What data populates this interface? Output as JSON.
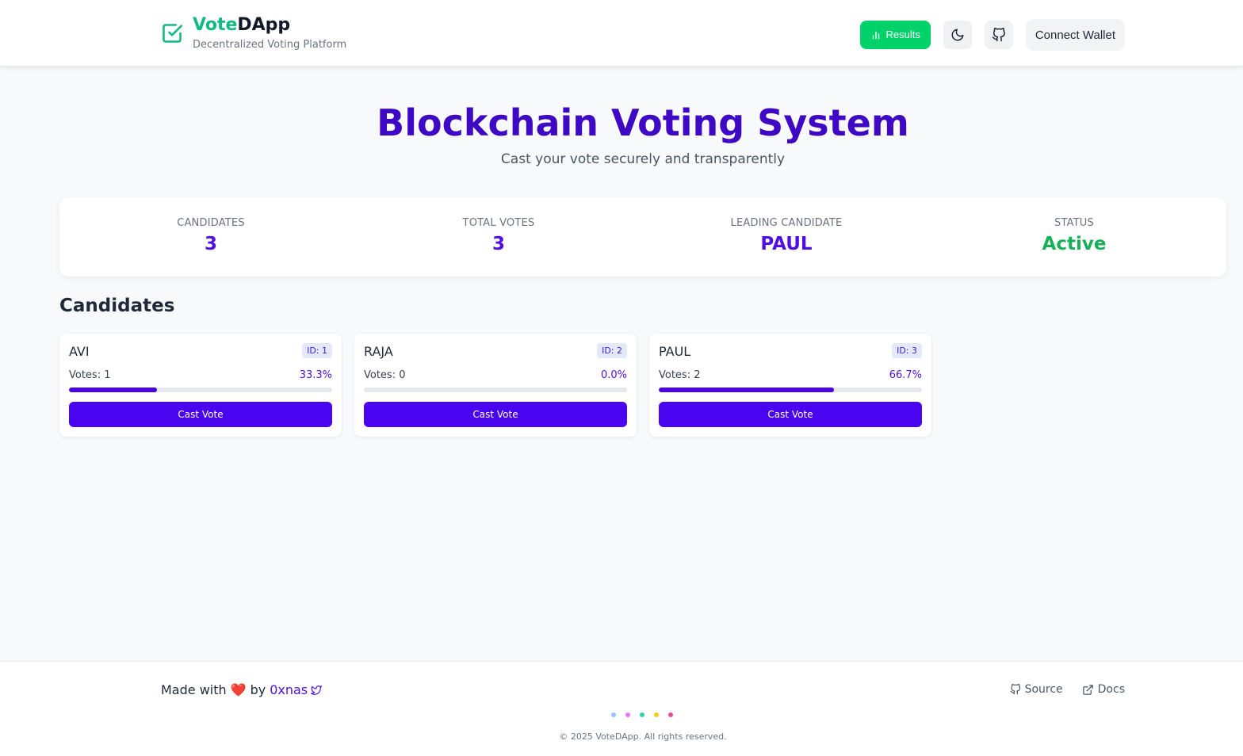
{
  "brand": {
    "title_part1": "Vote",
    "title_part2": "DApp",
    "subtitle": "Decentralized Voting Platform"
  },
  "header": {
    "results_label": "Results",
    "connect_wallet_label": "Connect Wallet"
  },
  "hero": {
    "title": "Blockchain Voting System",
    "subtitle": "Cast your vote securely and transparently"
  },
  "stats": [
    {
      "label": "CANDIDATES",
      "value": "3"
    },
    {
      "label": "TOTAL VOTES",
      "value": "3"
    },
    {
      "label": "LEADING CANDIDATE",
      "value": "PAUL"
    },
    {
      "label": "STATUS",
      "value": "Active"
    }
  ],
  "candidates_section": {
    "title": "Candidates",
    "vote_button_label": "Cast Vote",
    "items": [
      {
        "name": "AVI",
        "id_label": "ID: 1",
        "votes_label": "Votes: 1",
        "percent_label": "33.3%",
        "percent": 33.3
      },
      {
        "name": "RAJA",
        "id_label": "ID: 2",
        "votes_label": "Votes: 0",
        "percent_label": "0.0%",
        "percent": 0.0
      },
      {
        "name": "PAUL",
        "id_label": "ID: 3",
        "votes_label": "Votes: 2",
        "percent_label": "66.7%",
        "percent": 66.7
      }
    ]
  },
  "footer": {
    "made_with": "Made with",
    "heart": "❤️",
    "by": "by",
    "author": "0xnas",
    "source_label": "Source",
    "docs_label": "Docs",
    "dot_colors": [
      "#93c5fd",
      "#e879f9",
      "#34d399",
      "#facc15",
      "#ec4899"
    ],
    "copyright": "© 2025 VoteDApp. All rights reserved."
  },
  "colors": {
    "accent": "#4a05f0",
    "brand_green": "#00d26a",
    "status_active": "#16b056"
  }
}
